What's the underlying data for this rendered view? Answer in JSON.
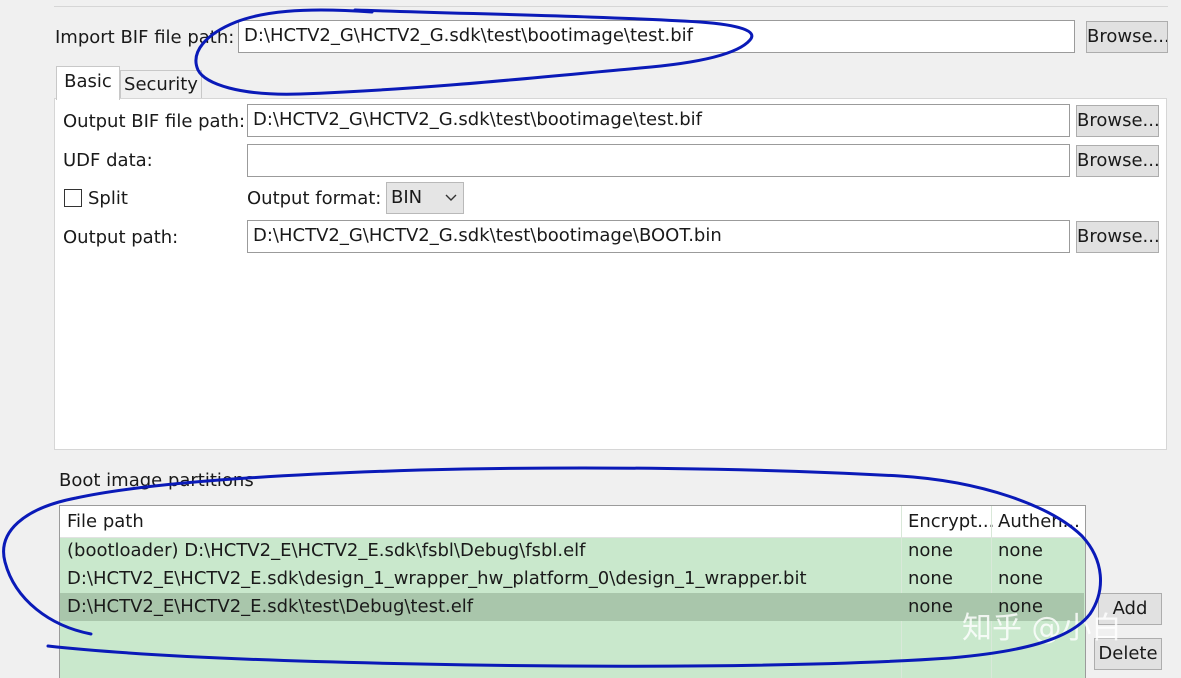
{
  "import_bif": {
    "label": "Import BIF file path:",
    "value": "D:\\HCTV2_G\\HCTV2_G.sdk\\test\\bootimage\\test.bif",
    "browse": "Browse..."
  },
  "tabs": [
    {
      "label": "Basic",
      "selected": true
    },
    {
      "label": "Security",
      "selected": false
    }
  ],
  "basic": {
    "output_bif": {
      "label": "Output BIF file path:",
      "value": "D:\\HCTV2_G\\HCTV2_G.sdk\\test\\bootimage\\test.bif",
      "browse": "Browse..."
    },
    "udf": {
      "label": "UDF data:",
      "value": "",
      "browse": "Browse..."
    },
    "split": {
      "label": "Split",
      "checked": false
    },
    "output_format": {
      "label": "Output format:",
      "value": "BIN"
    },
    "output_path": {
      "label": "Output path:",
      "value": "D:\\HCTV2_G\\HCTV2_G.sdk\\test\\bootimage\\BOOT.bin",
      "browse": "Browse..."
    }
  },
  "partitions": {
    "title": "Boot image partitions",
    "columns": [
      "File path",
      "Encrypt...",
      "Authen..."
    ],
    "rows": [
      {
        "path": "(bootloader) D:\\HCTV2_E\\HCTV2_E.sdk\\fsbl\\Debug\\fsbl.elf",
        "encrypt": "none",
        "auth": "none",
        "selected": false
      },
      {
        "path": "D:\\HCTV2_E\\HCTV2_E.sdk\\design_1_wrapper_hw_platform_0\\design_1_wrapper.bit",
        "encrypt": "none",
        "auth": "none",
        "selected": false
      },
      {
        "path": "D:\\HCTV2_E\\HCTV2_E.sdk\\test\\Debug\\test.elf",
        "encrypt": "none",
        "auth": "none",
        "selected": true
      }
    ],
    "add": "Add",
    "delete": "Delete"
  },
  "watermark": "知乎 @小白",
  "colors": {
    "table_bg": "#c9e8cc",
    "selected_row": "#a9c6ab",
    "ink": "#0a1ab8"
  }
}
